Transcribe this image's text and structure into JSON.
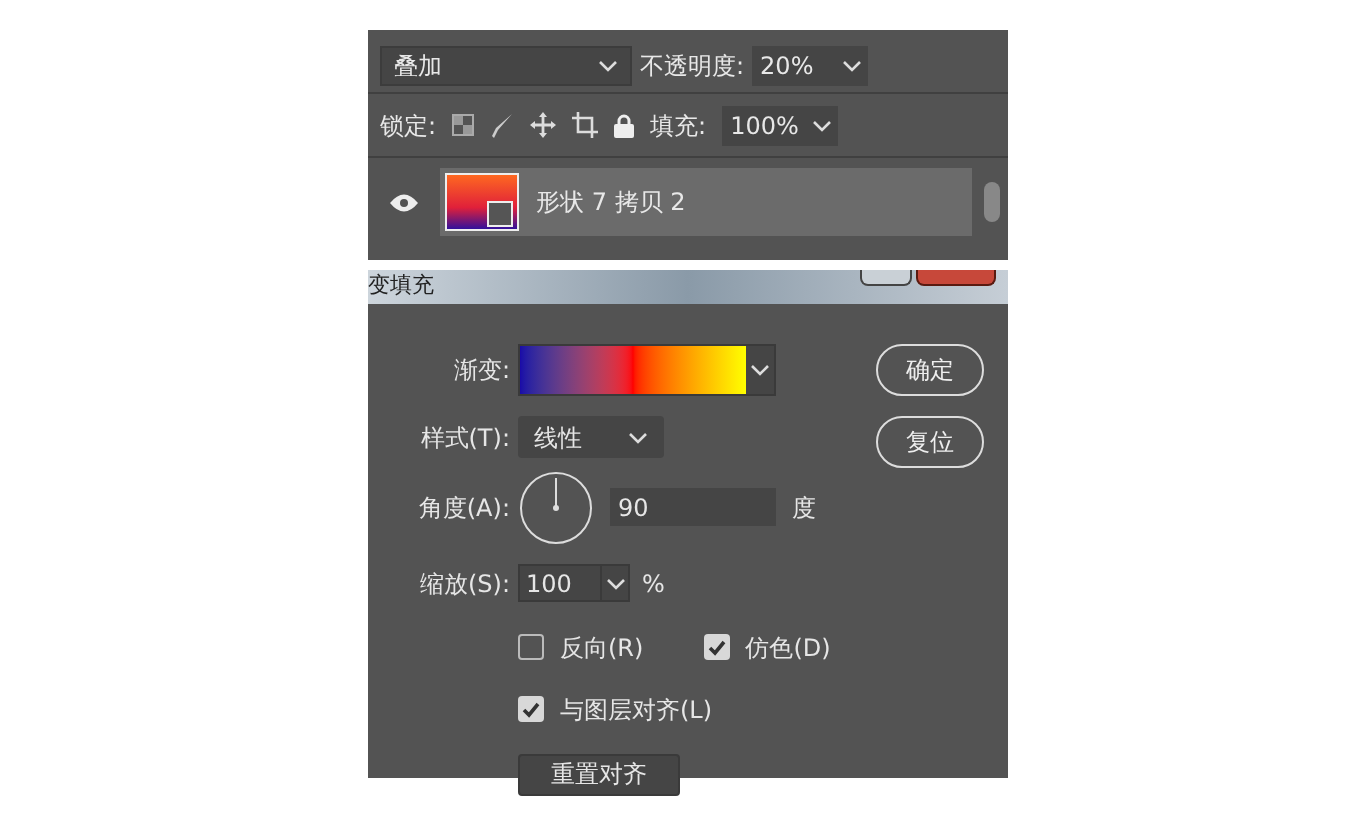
{
  "layers_panel": {
    "blend_mode": "叠加",
    "opacity_label": "不透明度:",
    "opacity": "20%",
    "lock_label": "锁定:",
    "fill_label": "填充:",
    "fill": "100%",
    "layer": {
      "name": "形状 7 拷贝 2",
      "visible": true,
      "selected": true
    }
  },
  "dialog": {
    "title": "变填充",
    "gradient_label": "渐变:",
    "style_label": "样式(T):",
    "style": "线性",
    "angle_label": "角度(A):",
    "angle": "90",
    "angle_unit": "度",
    "scale_label": "缩放(S):",
    "scale": "100",
    "scale_unit": "%",
    "checkboxes": [
      {
        "label": "反向(R)",
        "checked": false
      },
      {
        "label": "仿色(D)",
        "checked": true
      },
      {
        "label": "与图层对齐(L)",
        "checked": true
      }
    ],
    "reset_align_button": "重置对齐",
    "buttons": [
      "确定",
      "复位"
    ]
  }
}
